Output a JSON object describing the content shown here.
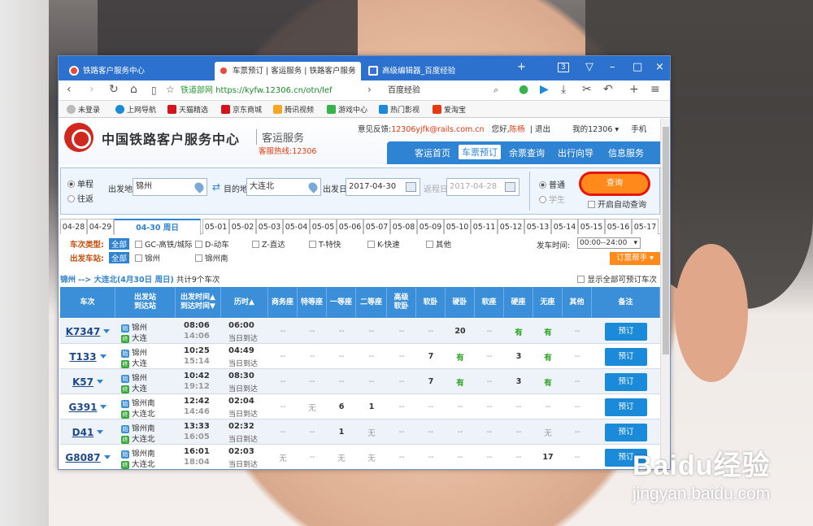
{
  "browser": {
    "tabs": [
      {
        "label": "铁路客户服务中心"
      },
      {
        "label": "车票预订 | 客运服务 | 铁路客户服务"
      },
      {
        "label": "高级编辑器_百度经验"
      }
    ],
    "tab_count": "3",
    "address": {
      "site": "铁道部网",
      "url": "https://kyfw.12306.cn/otn/lef"
    },
    "search_value": "百度经验",
    "bookmarks": [
      "未登录",
      "上网导航",
      "天猫精选",
      "京东商城",
      "腾讯视频",
      "游戏中心",
      "热门影视",
      "爱淘宝"
    ]
  },
  "site": {
    "brand": "中国铁路客户服务中心",
    "brand_sub": "客运服务",
    "hotline": "客服热线:12306",
    "feedback": "意见反馈:",
    "feedback_email": "12306yjfk@rails.com.cn",
    "greeting": "您好,",
    "user": "陈杨",
    "logout": "退出",
    "my12306": "我的12306",
    "mobile": "手机",
    "nav": [
      "客运首页",
      "车票预订",
      "余票查询",
      "出行向导",
      "信息服务"
    ]
  },
  "query": {
    "one_way": "单程",
    "round_trip": "往返",
    "from_label": "出发地",
    "from": "锦州",
    "to_label": "目的地",
    "to": "大连北",
    "date_label": "出发日",
    "date": "2017-04-30",
    "return_label": "返程日",
    "return_date": "2017-04-28",
    "normal": "普通",
    "student": "学生",
    "query_btn": "查询",
    "auto_query": "开启自动查询"
  },
  "dates": [
    "04-28",
    "04-29",
    "04-30 周日",
    "05-01",
    "05-02",
    "05-03",
    "05-04",
    "05-05",
    "05-06",
    "05-07",
    "05-08",
    "05-09",
    "05-10",
    "05-11",
    "05-12",
    "05-13",
    "05-14",
    "05-15",
    "05-16",
    "05-17"
  ],
  "filter": {
    "type_label": "车次类型:",
    "all": "全部",
    "types": [
      "GC-高铁/城际",
      "D-动车",
      "Z-直达",
      "T-特快",
      "K-快速",
      "其他"
    ],
    "station_label": "出发车站:",
    "stations": [
      "锦州",
      "锦州南"
    ],
    "time_label": "发车时间:",
    "time_value": "00:00--24:00",
    "helper": "订票帮手"
  },
  "route": {
    "text": "锦州 --> 大连北(4月30日 周日)",
    "count": "共计9个车次",
    "show_all": "显示全部可预订车次"
  },
  "table": {
    "headers": [
      "车次",
      "出发站\n到达站",
      "出发时间▲\n到达时间▼",
      "历时▲",
      "商务座",
      "特等座",
      "一等座",
      "二等座",
      "高级\n软卧",
      "软卧",
      "硬卧",
      "软座",
      "硬座",
      "无座",
      "其他",
      "备注"
    ],
    "book_label": "预订",
    "rows": [
      {
        "train": "K7347",
        "from": "锦州",
        "to": "大连",
        "dep": "08:06",
        "arr": "14:06",
        "dur": "06:00",
        "day": "当日到达",
        "seats": [
          "--",
          "--",
          "--",
          "--",
          "--",
          "--",
          "20",
          "--",
          "有",
          "有",
          "--"
        ]
      },
      {
        "train": "T133",
        "from": "锦州",
        "to": "大连",
        "dep": "10:25",
        "arr": "15:14",
        "dur": "04:49",
        "day": "当日到达",
        "seats": [
          "--",
          "--",
          "--",
          "--",
          "--",
          "7",
          "有",
          "--",
          "3",
          "有",
          "--"
        ]
      },
      {
        "train": "K57",
        "from": "锦州",
        "to": "大连",
        "dep": "10:42",
        "arr": "19:12",
        "dur": "08:30",
        "day": "当日到达",
        "seats": [
          "--",
          "--",
          "--",
          "--",
          "--",
          "7",
          "有",
          "--",
          "3",
          "有",
          "--"
        ]
      },
      {
        "train": "G391",
        "from": "锦州南",
        "to": "大连北",
        "dep": "12:42",
        "arr": "14:46",
        "dur": "02:04",
        "day": "当日到达",
        "seats": [
          "--",
          "无",
          "6",
          "1",
          "--",
          "--",
          "--",
          "--",
          "--",
          "--",
          "--"
        ]
      },
      {
        "train": "D41",
        "from": "锦州南",
        "to": "大连北",
        "dep": "13:33",
        "arr": "16:05",
        "dur": "02:32",
        "day": "当日到达",
        "seats": [
          "--",
          "--",
          "1",
          "无",
          "--",
          "--",
          "--",
          "--",
          "--",
          "无",
          "--"
        ]
      },
      {
        "train": "G8087",
        "from": "锦州南",
        "to": "大连北",
        "dep": "16:01",
        "arr": "18:04",
        "dur": "02:03",
        "day": "当日到达",
        "seats": [
          "无",
          "--",
          "无",
          "无",
          "--",
          "--",
          "--",
          "--",
          "--",
          "17",
          "--"
        ]
      }
    ]
  },
  "watermark": {
    "logo": "Baidu经验",
    "url": "jingyan.baidu.com"
  }
}
